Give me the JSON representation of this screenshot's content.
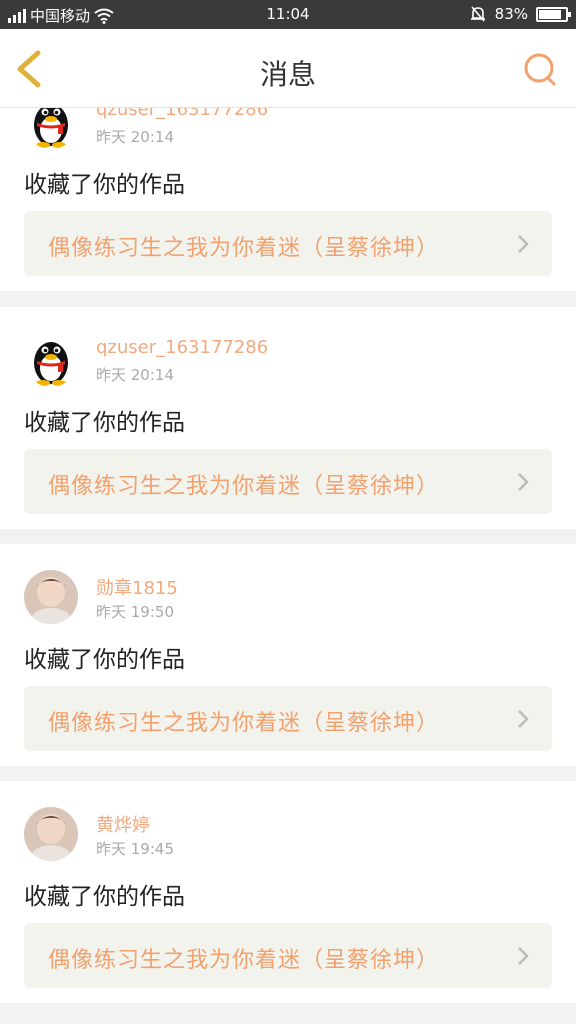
{
  "status_bar": {
    "carrier": "中国移动",
    "time": "11:04",
    "battery": "83%",
    "battery_level": 0.83
  },
  "header": {
    "title": "消息",
    "back_icon": "chevron-left-icon",
    "search_icon": "search-icon"
  },
  "colors": {
    "accent": "#f2a06c",
    "card_bg": "#ffffff",
    "work_bg": "#f3f3ee",
    "divider": "#f2f2f2"
  },
  "messages": [
    {
      "user": "qzuser_163177286",
      "time": "昨天 20:14",
      "action": "收藏了你的作品",
      "work": "偶像练习生之我为你着迷（呈蔡徐坤）",
      "avatar": "qq-penguin-avatar"
    },
    {
      "user": "qzuser_163177286",
      "time": "昨天 20:14",
      "action": "收藏了你的作品",
      "work": "偶像练习生之我为你着迷（呈蔡徐坤）",
      "avatar": "qq-penguin-avatar"
    },
    {
      "user": "勋章1815",
      "time": "昨天 19:50",
      "action": "收藏了你的作品",
      "work": "偶像练习生之我为你着迷（呈蔡徐坤）",
      "avatar": "user-photo-avatar"
    },
    {
      "user": "黄烨婷",
      "time": "昨天 19:45",
      "action": "收藏了你的作品",
      "work": "偶像练习生之我为你着迷（呈蔡徐坤）",
      "avatar": "user-photo-avatar"
    }
  ]
}
